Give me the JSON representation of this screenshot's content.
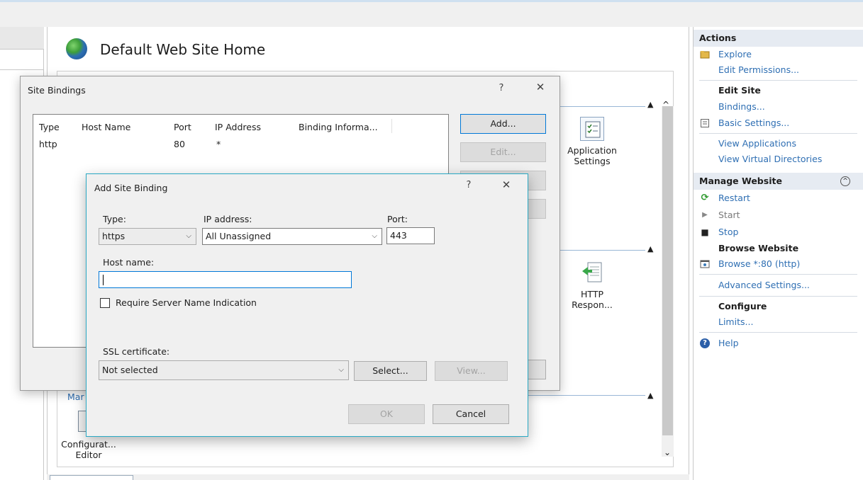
{
  "background": {
    "home_title": "Default Web Site Home",
    "features": [
      {
        "label_line1": "Application",
        "label_line2": "Settings"
      },
      {
        "label_line1": "HTTP",
        "label_line2": "Respon..."
      },
      {
        "label_line1": "Configurat...",
        "label_line2": "Editor"
      }
    ],
    "group_label_fragment": "Mar"
  },
  "actions": {
    "header": "Actions",
    "explore": "Explore",
    "edit_permissions": "Edit Permissions...",
    "edit_site": "Edit Site",
    "bindings": "Bindings...",
    "basic_settings": "Basic Settings...",
    "view_applications": "View Applications",
    "view_virtual_directories": "View Virtual Directories",
    "manage_website": "Manage Website",
    "restart": "Restart",
    "start": "Start",
    "stop": "Stop",
    "browse_website": "Browse Website",
    "browse_80": "Browse *:80 (http)",
    "advanced_settings": "Advanced Settings...",
    "configure": "Configure",
    "limits": "Limits...",
    "help": "Help"
  },
  "site_bindings": {
    "title": "Site Bindings",
    "help_glyph": "?",
    "close_glyph": "✕",
    "columns": [
      "Type",
      "Host Name",
      "Port",
      "IP Address",
      "Binding Informa..."
    ],
    "rows": [
      {
        "type": "http",
        "host": "",
        "port": "80",
        "ip": "*",
        "info": ""
      }
    ],
    "add_label": "Add...",
    "edit_label": "Edit..."
  },
  "add_binding": {
    "title": "Add Site Binding",
    "help_glyph": "?",
    "close_glyph": "✕",
    "type_label": "Type:",
    "type_value": "https",
    "ip_label": "IP address:",
    "ip_value": "All Unassigned",
    "port_label": "Port:",
    "port_value": "443",
    "host_label": "Host name:",
    "host_value": "",
    "sni_label": "Require Server Name Indication",
    "sni_checked": false,
    "ssl_label": "SSL certificate:",
    "ssl_value": "Not selected",
    "select_label": "Select...",
    "view_label": "View...",
    "ok_label": "OK",
    "cancel_label": "Cancel"
  }
}
